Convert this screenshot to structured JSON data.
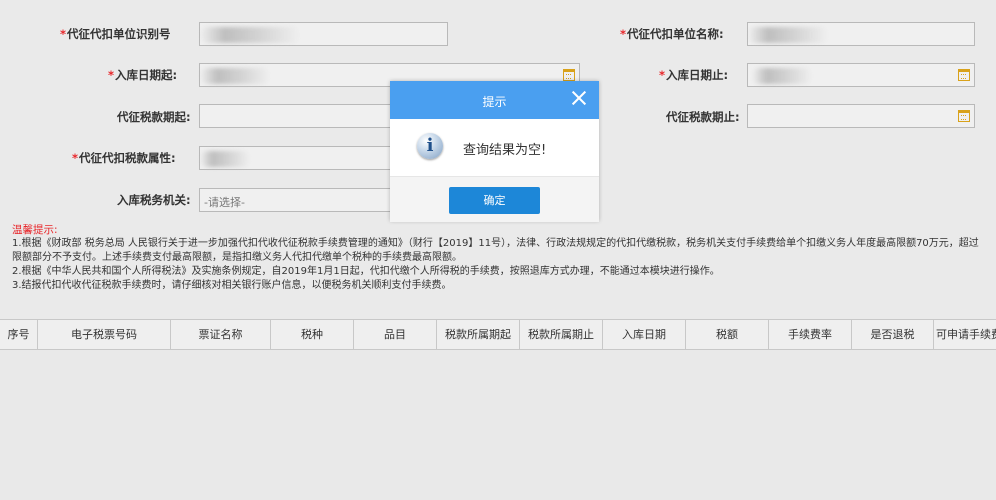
{
  "form": {
    "required_mark": "*",
    "agent_id_label": "代征代扣单位识别号",
    "agent_name_label": "代征代扣单位名称:",
    "storage_start_label": "入库日期起:",
    "storage_end_label": "入库日期止:",
    "tax_period_start_label": "代征税款期起:",
    "tax_period_end_label": "代征税款期止:",
    "tax_attr_label": "代征代扣税款属性:",
    "tax_office_label": "入库税务机关:",
    "tax_office_placeholder": "-请选择-"
  },
  "tips": {
    "title": "温馨提示:",
    "line1": "1.根据《财政部 税务总局 人民银行关于进一步加强代扣代收代征税款手续费管理的通知》（财行【2019】11号），法律、行政法规规定的代扣代缴税款，税务机关支付手续费给单个扣缴义务人年度最高限额70万元，超过限额部分不予支付。上述手续费支付最高限额，是指扣缴义务人代扣代缴单个税种的手续费最高限额。",
    "line2": "2.根据《中华人民共和国个人所得税法》及实施条例规定，自2019年1月1日起，代扣代缴个人所得税的手续费，按照退库方式办理，不能通过本模块进行操作。",
    "line3": "3.结报代扣代收代征税款手续费时，请仔细核对相关银行账户信息，以便税务机关顺利支付手续费。"
  },
  "table": {
    "columns": [
      "序号",
      "电子税票号码",
      "票证名称",
      "税种",
      "品目",
      "税款所属期起",
      "税款所属期止",
      "入库日期",
      "税额",
      "手续费率",
      "是否退税",
      "可申请手续费"
    ]
  },
  "dialog": {
    "title": "提示",
    "message": "查询结果为空!",
    "ok_label": "确定",
    "icon": "info-icon",
    "header_color": "#4a9ff0",
    "button_color": "#1d87d8"
  },
  "colors": {
    "required": "#e8262a",
    "calendar_icon": "#d9a21b"
  }
}
